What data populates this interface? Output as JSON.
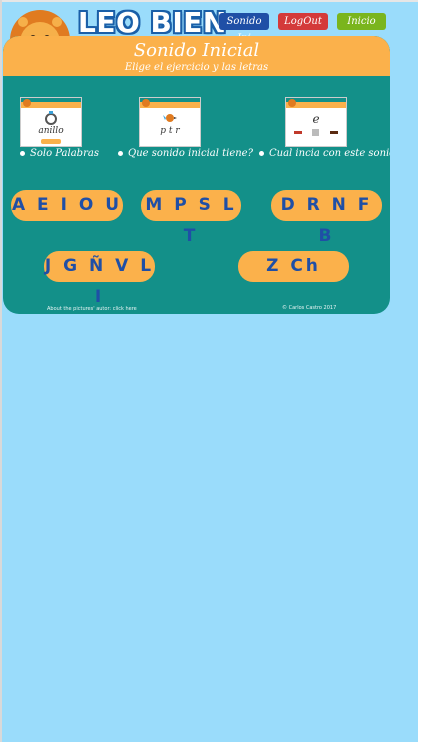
{
  "header": {
    "brand": "LEO BIEN",
    "nav": [
      {
        "label": "Sonido Ini"
      },
      {
        "label": "LogOut"
      },
      {
        "label": "Inicio"
      }
    ]
  },
  "panel": {
    "title": "Sonido Inicial",
    "subtitle": "Elige el ejercicio y las letras",
    "thumbnails": [
      {
        "text": "anillo"
      },
      {
        "text": "p   t   r"
      },
      {
        "text": "e"
      }
    ],
    "options": [
      {
        "label": "Solo Palabras"
      },
      {
        "label": "Que sonido inicial tiene?"
      },
      {
        "label": "Cual incia con este sonido?"
      }
    ],
    "letter_groups": [
      "A E I O U",
      "M P S L T",
      "D R N F B",
      "J G Ñ V L I",
      "Z Ch"
    ],
    "credit": "About the pictures' autor: click here",
    "copyright": "© Carlos Castro 2017"
  },
  "colors": {
    "background": "#9adcfb",
    "panel": "#139089",
    "accent": "#fbb14b",
    "letter_text": "#1f4fa6"
  }
}
